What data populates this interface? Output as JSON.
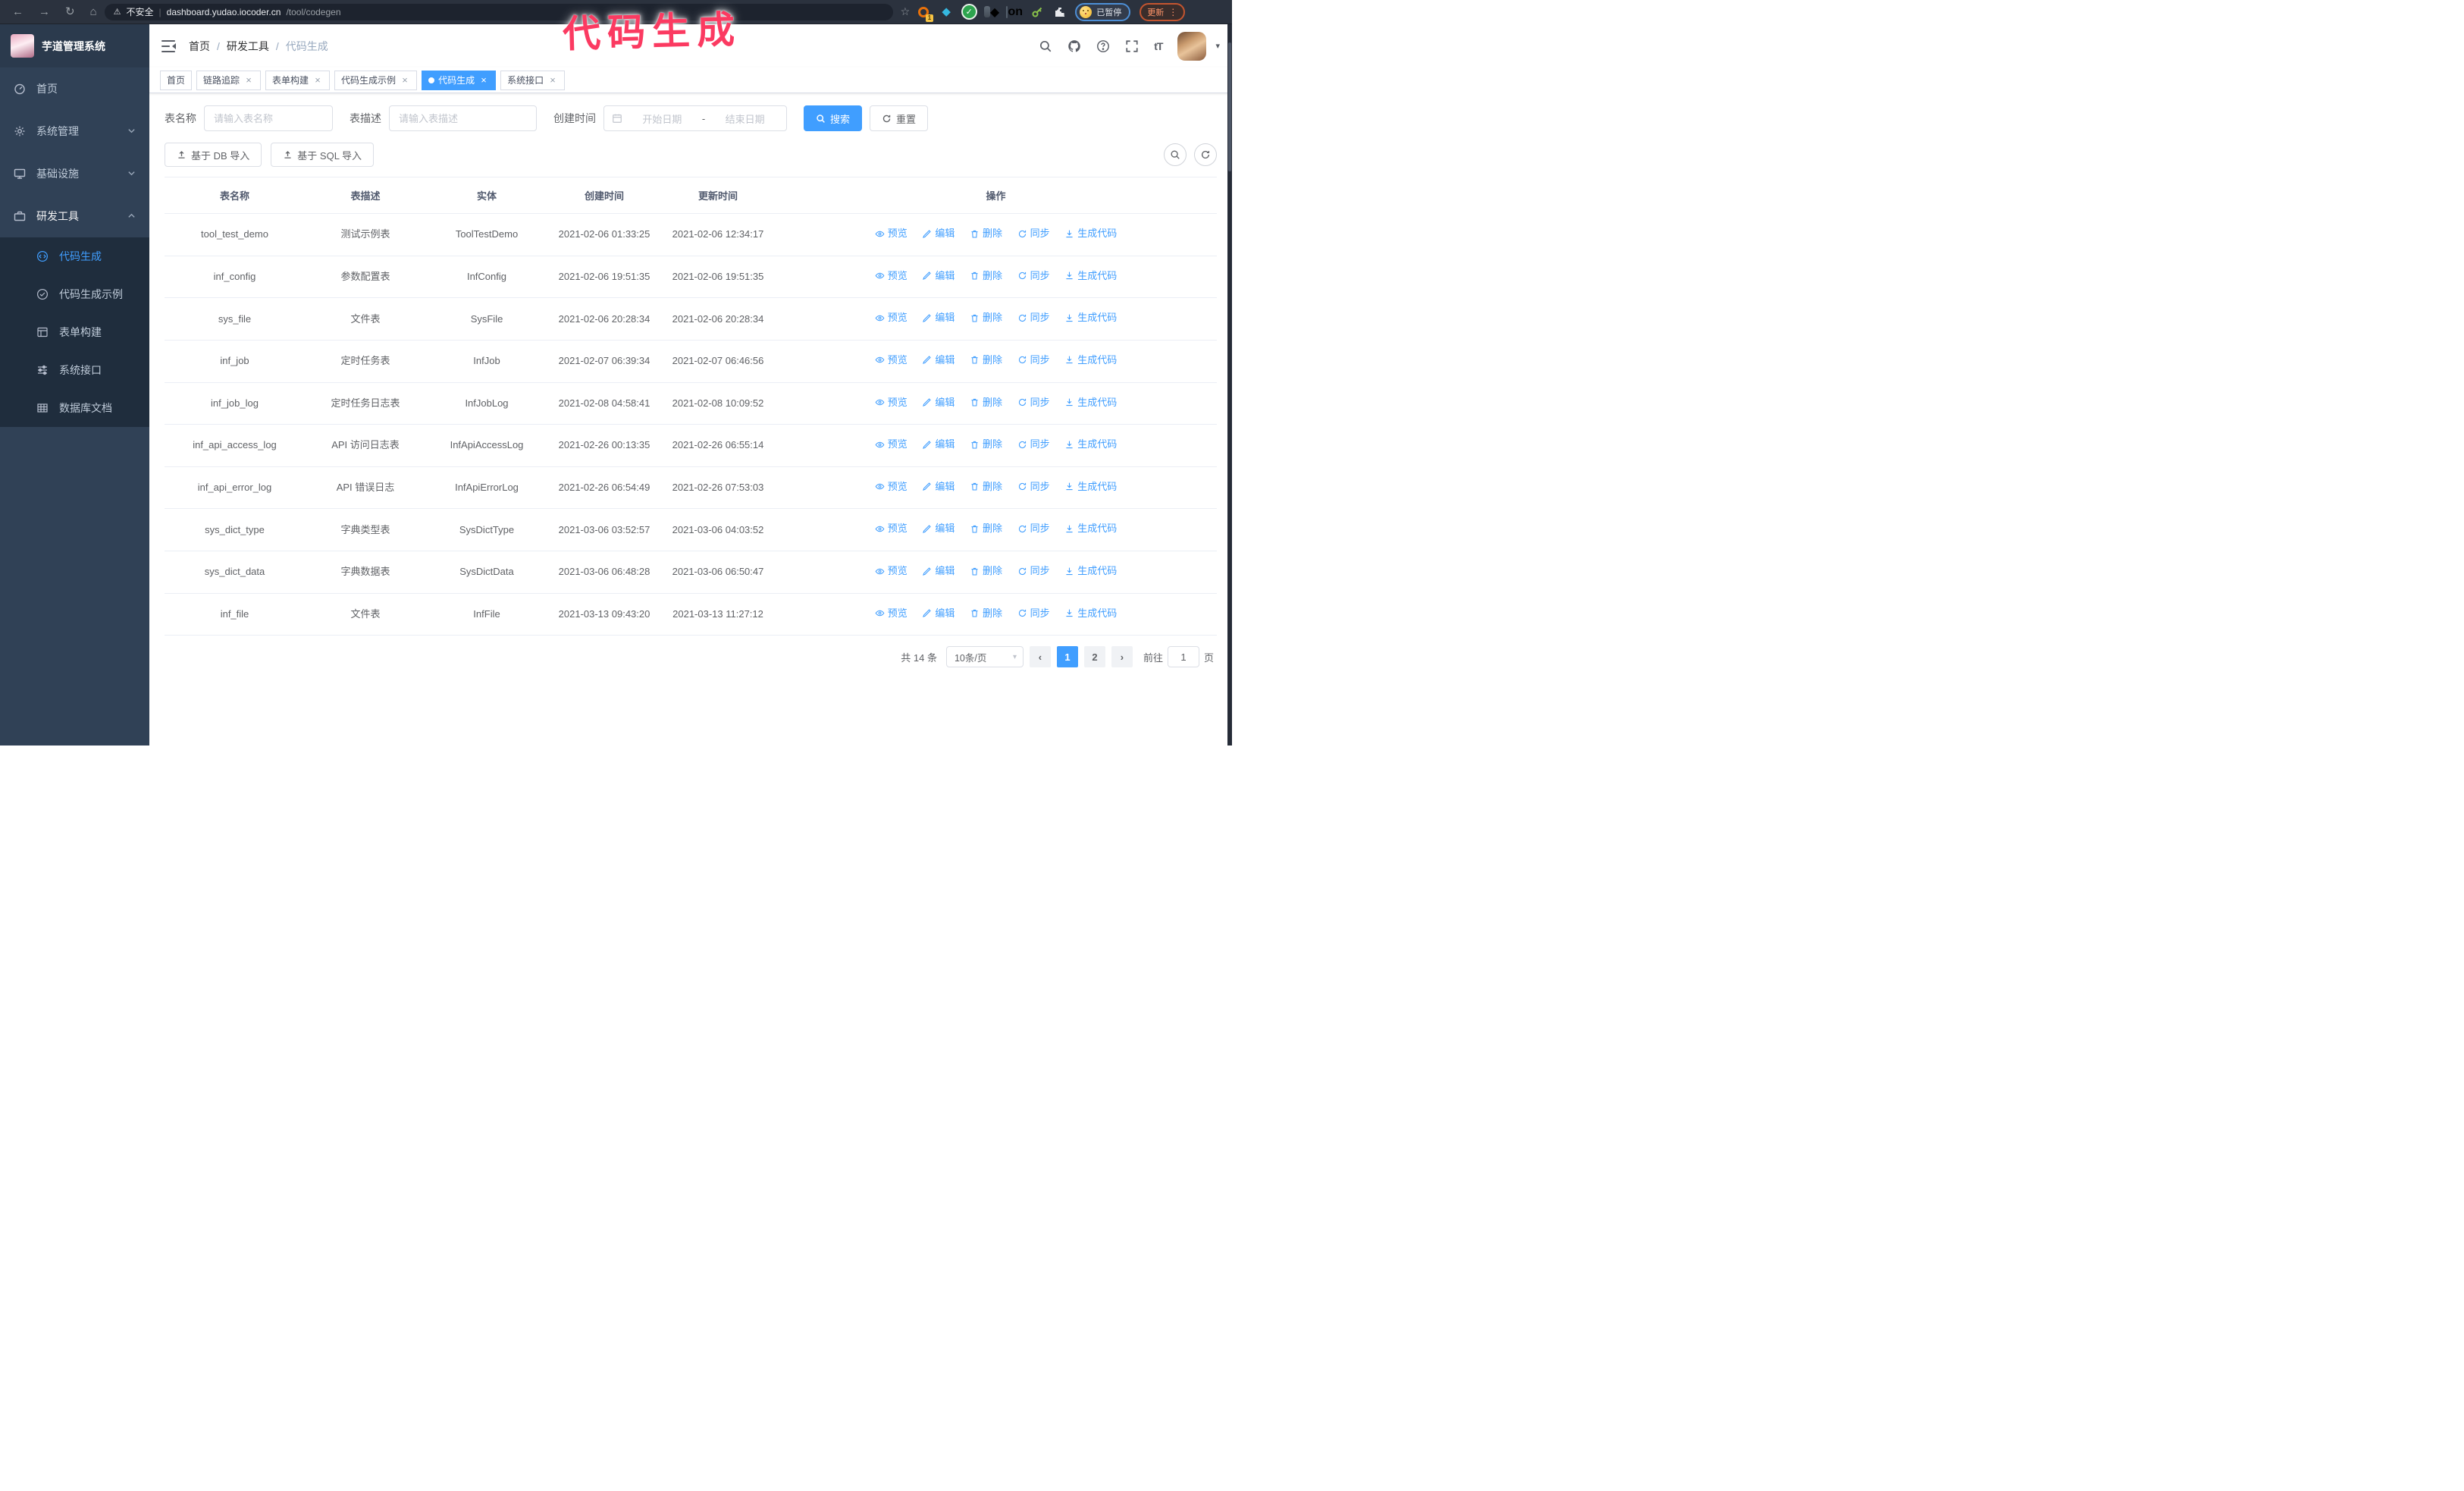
{
  "browser": {
    "url_security": "不安全",
    "url_host": "dashboard.yudao.iocoder.cn",
    "url_path": "/tool/codegen",
    "ext_count_badge": "1",
    "ext_on_badge": "on",
    "profile_chip": "已暂停",
    "update_button": "更新"
  },
  "annotation": {
    "text": "代码生成",
    "color": "#fb3a61"
  },
  "sidebar": {
    "title": "芋道管理系统",
    "items": [
      {
        "label": "首页"
      },
      {
        "label": "系统管理"
      },
      {
        "label": "基础设施"
      },
      {
        "label": "研发工具",
        "children": [
          {
            "label": "代码生成"
          },
          {
            "label": "代码生成示例"
          },
          {
            "label": "表单构建"
          },
          {
            "label": "系统接口"
          },
          {
            "label": "数据库文档"
          }
        ]
      }
    ]
  },
  "header": {
    "breadcrumb": [
      "首页",
      "研发工具",
      "代码生成"
    ]
  },
  "tabs": [
    {
      "label": "首页",
      "closable": false,
      "active": false
    },
    {
      "label": "链路追踪",
      "closable": true,
      "active": false
    },
    {
      "label": "表单构建",
      "closable": true,
      "active": false
    },
    {
      "label": "代码生成示例",
      "closable": true,
      "active": false
    },
    {
      "label": "代码生成",
      "closable": true,
      "active": true
    },
    {
      "label": "系统接口",
      "closable": true,
      "active": false
    }
  ],
  "filters": {
    "table_name_label": "表名称",
    "table_name_placeholder": "请输入表名称",
    "table_desc_label": "表描述",
    "table_desc_placeholder": "请输入表描述",
    "create_time_label": "创建时间",
    "date_start_placeholder": "开始日期",
    "date_separator": "-",
    "date_end_placeholder": "结束日期",
    "search_label": "搜索",
    "reset_label": "重置"
  },
  "toolbar": {
    "import_db_label": "基于 DB 导入",
    "import_sql_label": "基于 SQL 导入"
  },
  "table": {
    "columns": [
      "表名称",
      "表描述",
      "实体",
      "创建时间",
      "更新时间",
      "操作"
    ],
    "actions": [
      "预览",
      "编辑",
      "删除",
      "同步",
      "生成代码"
    ],
    "rows": [
      {
        "name": "tool_test_demo",
        "desc": "测试示例表",
        "entity": "ToolTestDemo",
        "created": "2021-02-06 01:33:25",
        "updated": "2021-02-06 12:34:17"
      },
      {
        "name": "inf_config",
        "desc": "参数配置表",
        "entity": "InfConfig",
        "created": "2021-02-06 19:51:35",
        "updated": "2021-02-06 19:51:35"
      },
      {
        "name": "sys_file",
        "desc": "文件表",
        "entity": "SysFile",
        "created": "2021-02-06 20:28:34",
        "updated": "2021-02-06 20:28:34"
      },
      {
        "name": "inf_job",
        "desc": "定时任务表",
        "entity": "InfJob",
        "created": "2021-02-07 06:39:34",
        "updated": "2021-02-07 06:46:56"
      },
      {
        "name": "inf_job_log",
        "desc": "定时任务日志表",
        "entity": "InfJobLog",
        "created": "2021-02-08 04:58:41",
        "updated": "2021-02-08 10:09:52"
      },
      {
        "name": "inf_api_access_log",
        "desc": "API 访问日志表",
        "entity": "InfApiAccessLog",
        "created": "2021-02-26 00:13:35",
        "updated": "2021-02-26 06:55:14"
      },
      {
        "name": "inf_api_error_log",
        "desc": "API 错误日志",
        "entity": "InfApiErrorLog",
        "created": "2021-02-26 06:54:49",
        "updated": "2021-02-26 07:53:03"
      },
      {
        "name": "sys_dict_type",
        "desc": "字典类型表",
        "entity": "SysDictType",
        "created": "2021-03-06 03:52:57",
        "updated": "2021-03-06 04:03:52"
      },
      {
        "name": "sys_dict_data",
        "desc": "字典数据表",
        "entity": "SysDictData",
        "created": "2021-03-06 06:48:28",
        "updated": "2021-03-06 06:50:47"
      },
      {
        "name": "inf_file",
        "desc": "文件表",
        "entity": "InfFile",
        "created": "2021-03-13 09:43:20",
        "updated": "2021-03-13 11:27:12"
      }
    ]
  },
  "pagination": {
    "total": "共 14 条",
    "page_size": "10条/页",
    "pages": [
      "1",
      "2"
    ],
    "active_page": "1",
    "goto_label": "前往",
    "goto_value": "1",
    "page_suffix": "页"
  },
  "colors": {
    "accent": "#409EFF",
    "annotation": "#fb3a61",
    "sidebar_bg": "#304156",
    "submenu_bg": "#1f2d3d",
    "chrome_bg": "#2b323e"
  }
}
